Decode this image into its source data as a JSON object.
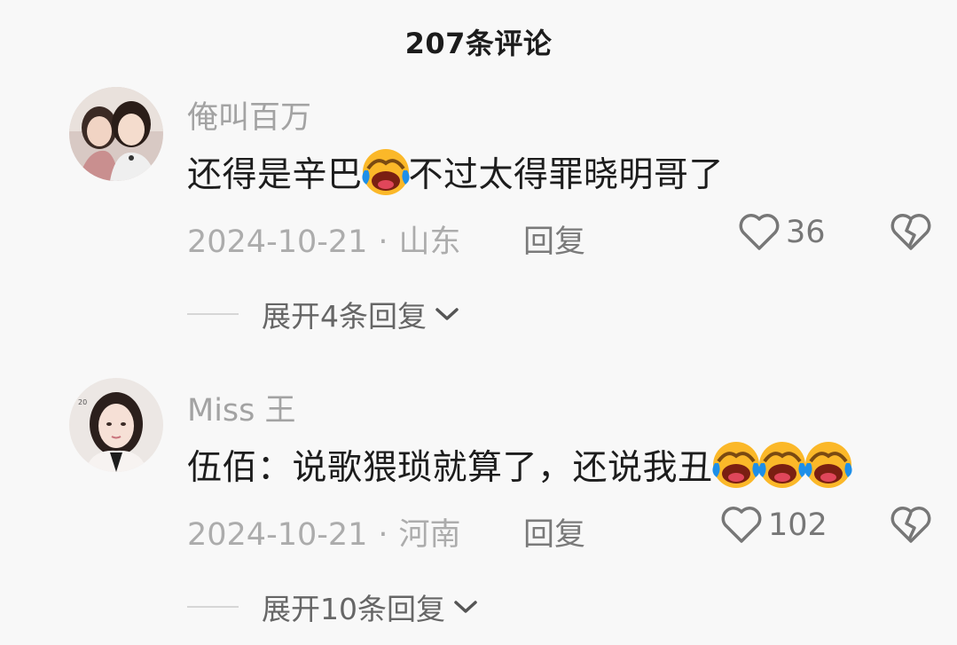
{
  "header": {
    "title": "207条评论"
  },
  "comments": [
    {
      "username": "俺叫百万",
      "text_parts": [
        "还得是辛巴",
        "不过太得罪晓明哥了"
      ],
      "emoji": "laugh-cry-emoji",
      "date": "2024-10-21",
      "dot": "·",
      "location": "山东",
      "reply_label": "回复",
      "likes": "36",
      "expand_label": "展开4条回复"
    },
    {
      "username": "Miss 王",
      "text_parts": [
        "伍佰：说歌猥琐就算了，还说我丑"
      ],
      "emoji": "laugh-cry-emoji",
      "emoji_count": 3,
      "date": "2024-10-21",
      "dot": "·",
      "location": "河南",
      "reply_label": "回复",
      "likes": "102",
      "expand_label": "展开10条回复"
    }
  ],
  "colors": {
    "background": "#f8f8f8",
    "text_primary": "#1d1d1d",
    "text_muted": "#a3a3a3",
    "emoji_yellow": "#fbb829",
    "emoji_blue": "#1e8fe8"
  },
  "icons": [
    "heart-icon",
    "broken-heart-icon",
    "chevron-down-icon",
    "laugh-cry-emoji"
  ]
}
